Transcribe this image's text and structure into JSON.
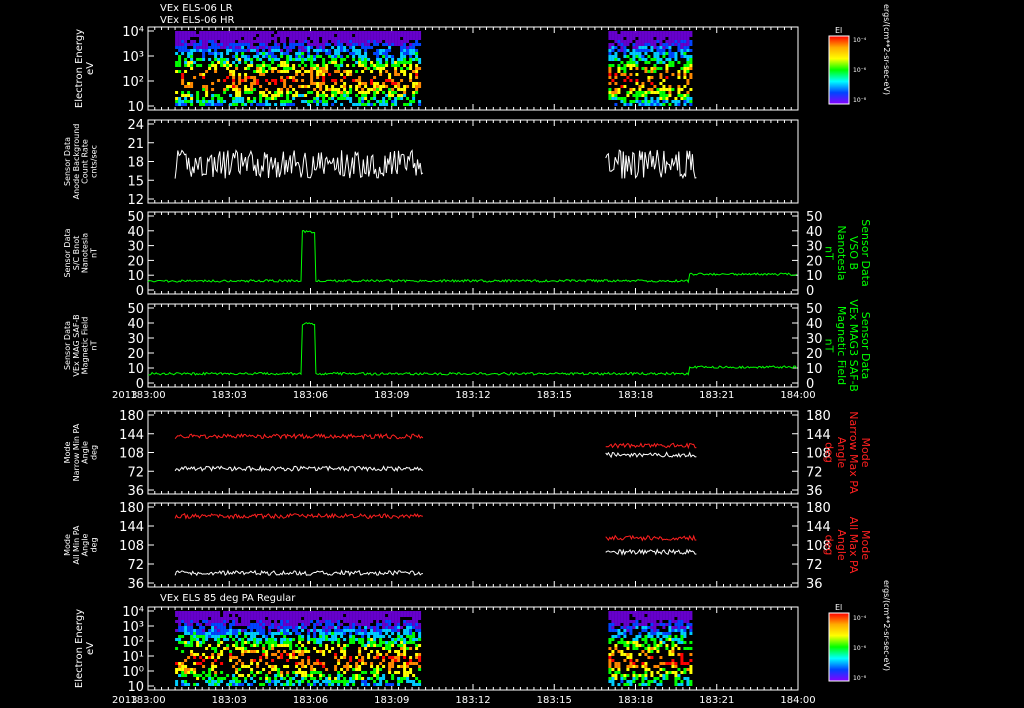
{
  "header": {
    "line1": "VEx ELS-06 LR",
    "line2": "VEx ELS-06 HR",
    "panel7_title": "VEx ELS 85 deg PA Regular"
  },
  "colors": {
    "white": "#ffffff",
    "green": "#00ff00",
    "red": "#ff2020",
    "bg": "#000000"
  },
  "colorbar": {
    "title": "El",
    "ticks": [
      "10⁻⁴",
      "10⁻⁶",
      "10⁻⁸"
    ],
    "unit": "ergs/(cm**2-sr-sec-eV)"
  },
  "xaxis": {
    "year": "2013",
    "ticks": [
      "183:00",
      "183:03",
      "183:06",
      "183:09",
      "183:12",
      "183:15",
      "183:18",
      "183:21",
      "184:00"
    ]
  },
  "chart_data": [
    {
      "id": "p1",
      "type": "heatmap",
      "ylabel": [
        "Electron Energy",
        "eV"
      ],
      "y_ticks": [
        "10⁴",
        "10³",
        "10²",
        "10"
      ],
      "segments": [
        [
          1,
          10
        ],
        [
          17,
          20
        ]
      ],
      "scale": "log",
      "ylim": [
        1,
        10000
      ]
    },
    {
      "id": "p2",
      "type": "line",
      "ylabel": [
        "Sensor Data",
        "Anode Background",
        "Count Rate",
        "cnts/sec"
      ],
      "y_ticks": [
        "24",
        "21",
        "18",
        "15",
        "12"
      ],
      "ylim": [
        9,
        24
      ],
      "series": [
        {
          "color": "#ffffff",
          "segments": [
            [
              1,
              10.2
            ],
            [
              16.9,
              20.3
            ]
          ],
          "level": 16,
          "spread": 2.6
        }
      ]
    },
    {
      "id": "p3",
      "type": "line",
      "ylabel": [
        "Sensor Data",
        "S/C Bnot",
        "Nanotesla",
        "nT"
      ],
      "ylabel_right": [
        "Sensor Data",
        "VSO B",
        "Nanotesla",
        "nT"
      ],
      "y_ticks": [
        "50",
        "40",
        "30",
        "20",
        "10",
        "0"
      ],
      "ylim": [
        0,
        50
      ],
      "series": [
        {
          "color": "#00ff00",
          "level": 8,
          "spike_at": 5.9,
          "spike": 38
        }
      ]
    },
    {
      "id": "p4",
      "type": "line",
      "ylabel": [
        "Sensor Data",
        "VEx MAG SAF-B",
        "Magnetic Field",
        "nT"
      ],
      "ylabel_right": [
        "Sensor Data",
        "VEx MAG3 SAF-B",
        "Magnetic Field",
        "nT"
      ],
      "y_ticks": [
        "50",
        "40",
        "30",
        "20",
        "10",
        "0"
      ],
      "ylim": [
        0,
        50
      ],
      "series": [
        {
          "color": "#00ff00",
          "level": 8,
          "spike_at": 5.9,
          "spike": 38
        }
      ]
    },
    {
      "id": "p5",
      "type": "line",
      "ylabel": [
        "Mode",
        "Narrow Min PA",
        "Angle",
        "deg"
      ],
      "ylabel_right": [
        "Mode",
        "Narrow Max PA",
        "Angle",
        "deg"
      ],
      "y_ticks": [
        "180",
        "144",
        "108",
        "72",
        "36"
      ],
      "ylim": [
        0,
        180
      ],
      "series": [
        {
          "color": "#ff2020",
          "segments": [
            [
              1,
              10.2
            ],
            [
              16.9,
              20.3
            ]
          ],
          "level": 125,
          "level2": 105
        },
        {
          "color": "#ffffff",
          "segments": [
            [
              1,
              10.2
            ],
            [
              16.9,
              20.3
            ]
          ],
          "level": 55,
          "level2": 85
        }
      ]
    },
    {
      "id": "p6",
      "type": "line",
      "ylabel": [
        "Mode",
        "All Min PA",
        "Angle",
        "deg"
      ],
      "ylabel_right": [
        "Mode",
        "All Max PA",
        "Angle",
        "deg"
      ],
      "y_ticks": [
        "180",
        "144",
        "108",
        "72",
        "36"
      ],
      "ylim": [
        0,
        180
      ],
      "series": [
        {
          "color": "#ff2020",
          "segments": [
            [
              1,
              10.2
            ],
            [
              16.9,
              20.3
            ]
          ],
          "level": 152,
          "level2": 105
        },
        {
          "color": "#ffffff",
          "segments": [
            [
              1,
              10.2
            ],
            [
              16.9,
              20.3
            ]
          ],
          "level": 30,
          "level2": 75
        }
      ]
    },
    {
      "id": "p7",
      "type": "heatmap",
      "ylabel": [
        "Electron Energy",
        "eV"
      ],
      "y_ticks": [
        "10⁴",
        "10³",
        "10²",
        "10¹",
        "10⁰",
        "10"
      ],
      "segments": [
        [
          1,
          10
        ],
        [
          17,
          20
        ]
      ],
      "scale": "log",
      "ylim": [
        0.1,
        10000
      ]
    }
  ]
}
